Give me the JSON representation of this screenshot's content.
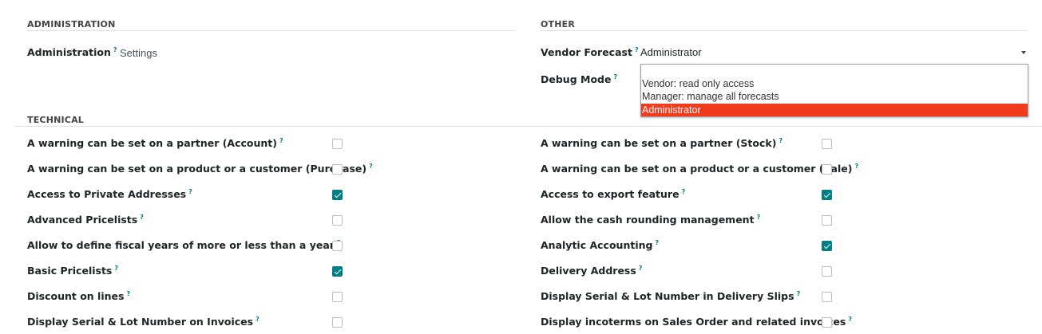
{
  "sections": {
    "administration": "ADMINISTRATION",
    "other": "OTHER",
    "technical": "TECHNICAL"
  },
  "administration": {
    "label": "Administration",
    "help": "?",
    "value": "Settings"
  },
  "other": {
    "vendor_forecast": {
      "label": "Vendor Forecast",
      "help": "?",
      "value": "Administrator",
      "options": [
        "Vendor: read only access",
        "Manager: manage all forecasts",
        "Administrator"
      ],
      "selected_index": 2
    },
    "debug_mode": {
      "label": "Debug Mode",
      "help": "?"
    }
  },
  "technical": {
    "left": [
      {
        "label": "A warning can be set on a partner (Account)",
        "checked": false
      },
      {
        "label": "A warning can be set on a product or a customer (Purchase)",
        "checked": false
      },
      {
        "label": "Access to Private Addresses",
        "checked": true
      },
      {
        "label": "Advanced Pricelists",
        "checked": false
      },
      {
        "label": "Allow to define fiscal years of more or less than a year",
        "checked": false
      },
      {
        "label": "Basic Pricelists",
        "checked": true
      },
      {
        "label": "Discount on lines",
        "checked": false
      },
      {
        "label": "Display Serial & Lot Number on Invoices",
        "checked": false
      }
    ],
    "right": [
      {
        "label": "A warning can be set on a partner (Stock)",
        "checked": false
      },
      {
        "label": "A warning can be set on a product or a customer (Sale)",
        "checked": false
      },
      {
        "label": "Access to export feature",
        "checked": true
      },
      {
        "label": "Allow the cash rounding management",
        "checked": false
      },
      {
        "label": "Analytic Accounting",
        "checked": true
      },
      {
        "label": "Delivery Address",
        "checked": false
      },
      {
        "label": "Display Serial & Lot Number in Delivery Slips",
        "checked": false
      },
      {
        "label": "Display incoterms on Sales Order and related invoices",
        "checked": false
      }
    ]
  },
  "colors": {
    "accent": "#017e84",
    "dropdown_selected": "#f23b1d"
  }
}
